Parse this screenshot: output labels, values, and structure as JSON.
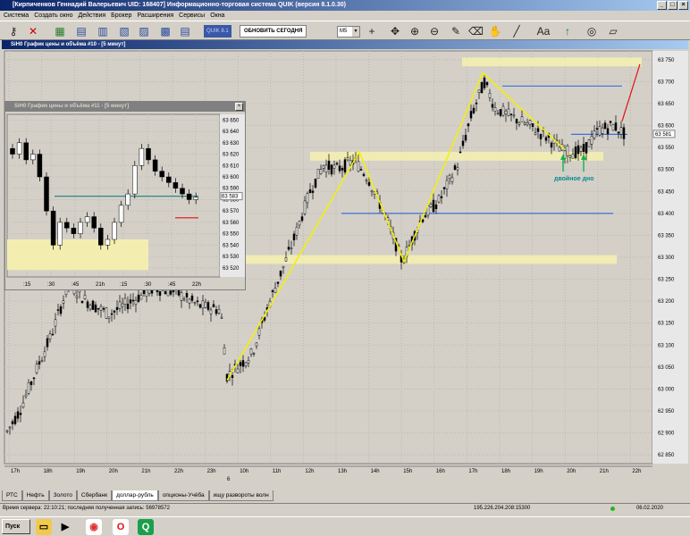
{
  "window": {
    "title": "[Кирпиченков Геннадий Валерьевич UID: 168407] Информационно-торговая система QUIK (версия 8.1.0.30)"
  },
  "menu": [
    "Система",
    "Создать окно",
    "Действия",
    "Брокер",
    "Расширения",
    "Сервисы",
    "Окна"
  ],
  "toolbar": {
    "quik_label": "QUIK 8.1",
    "update_label": "ОБНОВИТЬ СЕГОДНЯ",
    "timeframe": "M5"
  },
  "main_chart": {
    "title": "SiH0 График цены и объёма #10 - [5 минут]",
    "y_ticks": [
      "63 750",
      "63 700",
      "63 650",
      "63 600",
      "63 550",
      "63 500",
      "63 450",
      "63 400",
      "63 350",
      "63 300",
      "63 250",
      "63 200",
      "63 150",
      "63 100",
      "63 050",
      "63 000",
      "62 950",
      "62 900",
      "62 850"
    ],
    "price_label": "63 581",
    "x_ticks": [
      "17h",
      "18h",
      "19h",
      "20h",
      "21h",
      "22h",
      "23h",
      "10h",
      "11h",
      "12h",
      "13h",
      "14h",
      "15h",
      "16h",
      "17h",
      "18h",
      "19h",
      "20h",
      "21h",
      "22h"
    ],
    "day_label": "6",
    "annotation": "двойное дно",
    "colors": {
      "zone": "#f3eeb0",
      "level": "#3a6fd8",
      "trend": "#f5f000",
      "signal": "#e01010",
      "arrow": "#10b050"
    }
  },
  "sub_chart": {
    "title": "SiH0 График цены и объёма #11 - [5 минут]",
    "y_ticks": [
      "63 650",
      "63 640",
      "63 630",
      "63 620",
      "63 610",
      "63 600",
      "63 590",
      "63 580",
      "63 570",
      "63 560",
      "63 550",
      "63 540",
      "63 530",
      "63 520"
    ],
    "price_label": "63 583",
    "x_ticks": [
      ":15",
      ":30",
      ":45",
      "21h",
      ":15",
      ":30",
      ":45",
      "22h"
    ]
  },
  "tabs": [
    "РТС",
    "Нефть",
    "Золото",
    "Сбербанк",
    "доллар-рубль",
    "опционы-Учёба",
    "ищу развороты волн"
  ],
  "active_tab": 4,
  "status": {
    "left": "Время сервера: 22:10:21; последняя полученная запись: 56978572",
    "connection": "195.226.204.208:15300",
    "date": "06.02.2020"
  },
  "taskbar": {
    "start_label": "Пуск"
  }
}
